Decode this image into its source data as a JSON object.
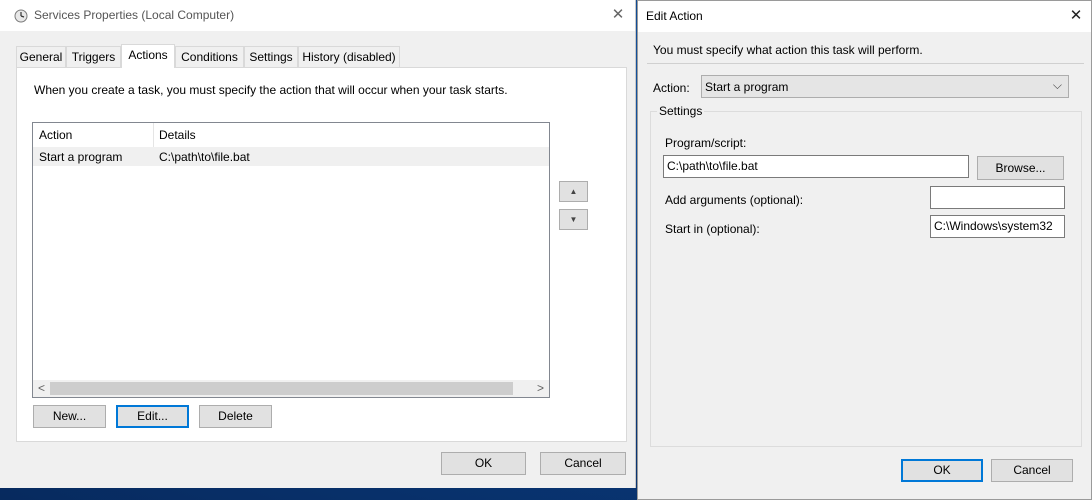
{
  "services_window": {
    "title": "Services Properties (Local Computer)",
    "close_glyph": "✕",
    "tabs": [
      {
        "label": "General"
      },
      {
        "label": "Triggers"
      },
      {
        "label": "Actions"
      },
      {
        "label": "Conditions"
      },
      {
        "label": "Settings"
      },
      {
        "label": "History (disabled)"
      }
    ],
    "active_tab": "Actions",
    "intro_text": "When you create a task, you must specify the action that will occur when your task starts.",
    "table": {
      "headers": [
        "Action",
        "Details"
      ],
      "rows": [
        {
          "action": "Start a program",
          "details": "C:\\path\\to\\file.bat"
        }
      ]
    },
    "move_up_glyph": "▲",
    "move_down_glyph": "▼",
    "scroll_left_glyph": "<",
    "scroll_right_glyph": ">",
    "buttons": {
      "new": "New...",
      "edit": "Edit...",
      "delete": "Delete",
      "ok": "OK",
      "cancel": "Cancel"
    }
  },
  "edit_action_dialog": {
    "title": "Edit Action",
    "close_glyph": "✕",
    "instruction": "You must specify what action this task will perform.",
    "action_label": "Action:",
    "action_value": "Start a program",
    "dropdown_glyph": "⌵",
    "settings_label": "Settings",
    "program_label": "Program/script:",
    "program_value": "C:\\path\\to\\file.bat",
    "browse_label": "Browse...",
    "arguments_label": "Add arguments (optional):",
    "arguments_value": "",
    "start_in_label": "Start in (optional):",
    "start_in_value": "C:\\Windows\\system32",
    "ok_label": "OK",
    "cancel_label": "Cancel"
  },
  "colors": {
    "desktop": "#0b3f86",
    "selection_row": "#f0f0f0",
    "focus_border": "#0078d7"
  }
}
